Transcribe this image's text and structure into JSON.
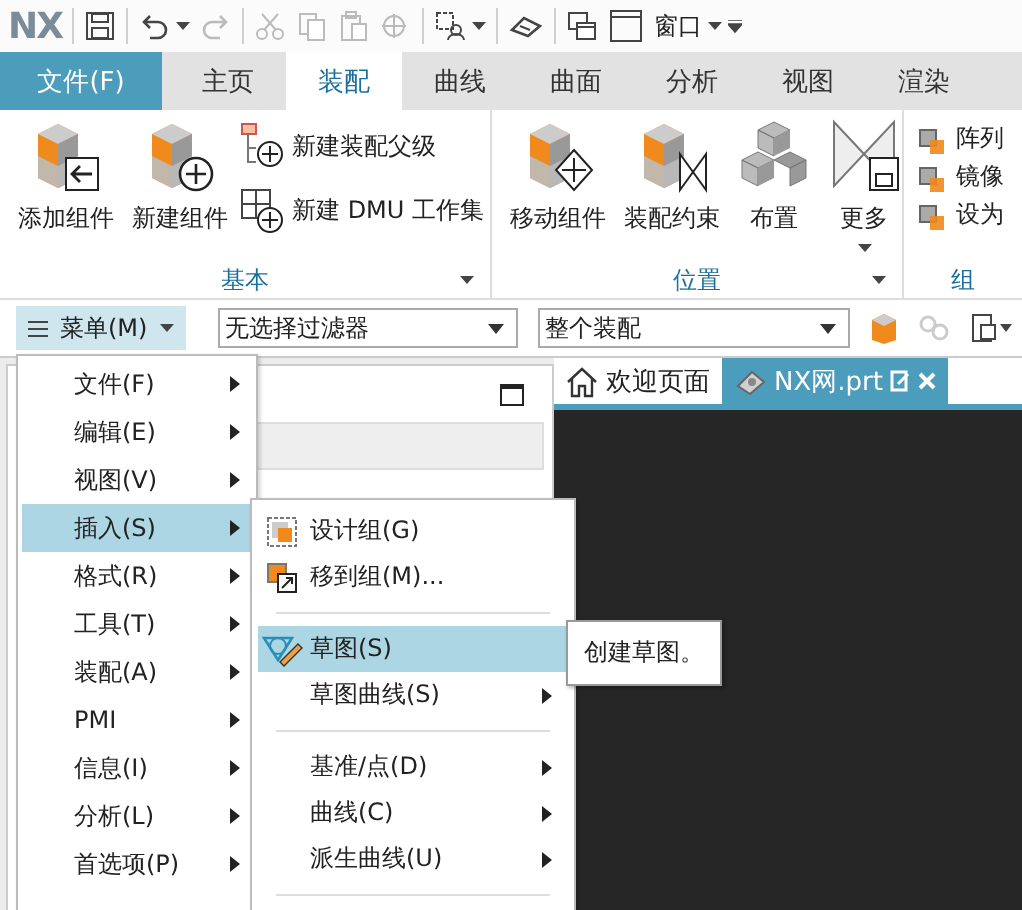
{
  "quick_access": {
    "logo": "NX",
    "window_label": "窗口"
  },
  "ribbon_tabs": [
    {
      "label": "文件(F)",
      "kind": "file",
      "selected": false
    },
    {
      "label": "主页",
      "kind": "tab",
      "selected": false
    },
    {
      "label": "装配",
      "kind": "tab",
      "selected": true
    },
    {
      "label": "曲线",
      "kind": "tab",
      "selected": false
    },
    {
      "label": "曲面",
      "kind": "tab",
      "selected": false
    },
    {
      "label": "分析",
      "kind": "tab",
      "selected": false
    },
    {
      "label": "视图",
      "kind": "tab",
      "selected": false
    },
    {
      "label": "渲染",
      "kind": "tab",
      "selected": false
    }
  ],
  "ribbon_groups": [
    {
      "label": "基本",
      "tools": [
        {
          "label": "添加组件",
          "kind": "large"
        },
        {
          "label": "新建组件",
          "kind": "large"
        },
        {
          "label": "新建装配父级",
          "kind": "small"
        },
        {
          "label": "新建 DMU 工作集",
          "kind": "small"
        }
      ]
    },
    {
      "label": "位置",
      "tools": [
        {
          "label": "移动组件",
          "kind": "large"
        },
        {
          "label": "装配约束",
          "kind": "large"
        },
        {
          "label": "布置",
          "kind": "large"
        },
        {
          "label": "更多",
          "kind": "more"
        }
      ]
    },
    {
      "label": "组",
      "tools": [
        {
          "label": "阵列",
          "kind": "small"
        },
        {
          "label": "镜像",
          "kind": "small"
        },
        {
          "label": "设为",
          "kind": "small"
        }
      ]
    }
  ],
  "toolbar": {
    "menu_button": "菜单(M)",
    "filters": [
      {
        "value": "无选择过滤器"
      },
      {
        "value": "整个装配"
      }
    ]
  },
  "doc_tabs": [
    {
      "label": "欢迎页面",
      "selected": false
    },
    {
      "label": "NX网.prt",
      "selected": true
    }
  ],
  "menu": {
    "items": [
      {
        "label": "文件(F)",
        "selected": false
      },
      {
        "label": "编辑(E)",
        "selected": false
      },
      {
        "label": "视图(V)",
        "selected": false
      },
      {
        "label": "插入(S)",
        "selected": true
      },
      {
        "label": "格式(R)",
        "selected": false
      },
      {
        "label": "工具(T)",
        "selected": false
      },
      {
        "label": "装配(A)",
        "selected": false
      },
      {
        "label": "PMI",
        "selected": false
      },
      {
        "label": "信息(I)",
        "selected": false
      },
      {
        "label": "分析(L)",
        "selected": false
      },
      {
        "label": "首选项(P)",
        "selected": false
      }
    ]
  },
  "submenu": {
    "items": [
      {
        "kind": "item",
        "label": "设计组(G)",
        "selected": false,
        "has_submenu": false
      },
      {
        "kind": "item",
        "label": "移到组(M)...",
        "selected": false,
        "has_submenu": false
      },
      {
        "kind": "separator"
      },
      {
        "kind": "item",
        "label": "草图(S)",
        "selected": true,
        "has_submenu": false
      },
      {
        "kind": "item",
        "label": "草图曲线(S)",
        "selected": false,
        "has_submenu": true
      },
      {
        "kind": "separator"
      },
      {
        "kind": "item",
        "label": "基准/点(D)",
        "selected": false,
        "has_submenu": true
      },
      {
        "kind": "item",
        "label": "曲线(C)",
        "selected": false,
        "has_submenu": true
      },
      {
        "kind": "item",
        "label": "派生曲线(U)",
        "selected": false,
        "has_submenu": true
      },
      {
        "kind": "separator"
      }
    ]
  },
  "tooltip": "创建草图。"
}
